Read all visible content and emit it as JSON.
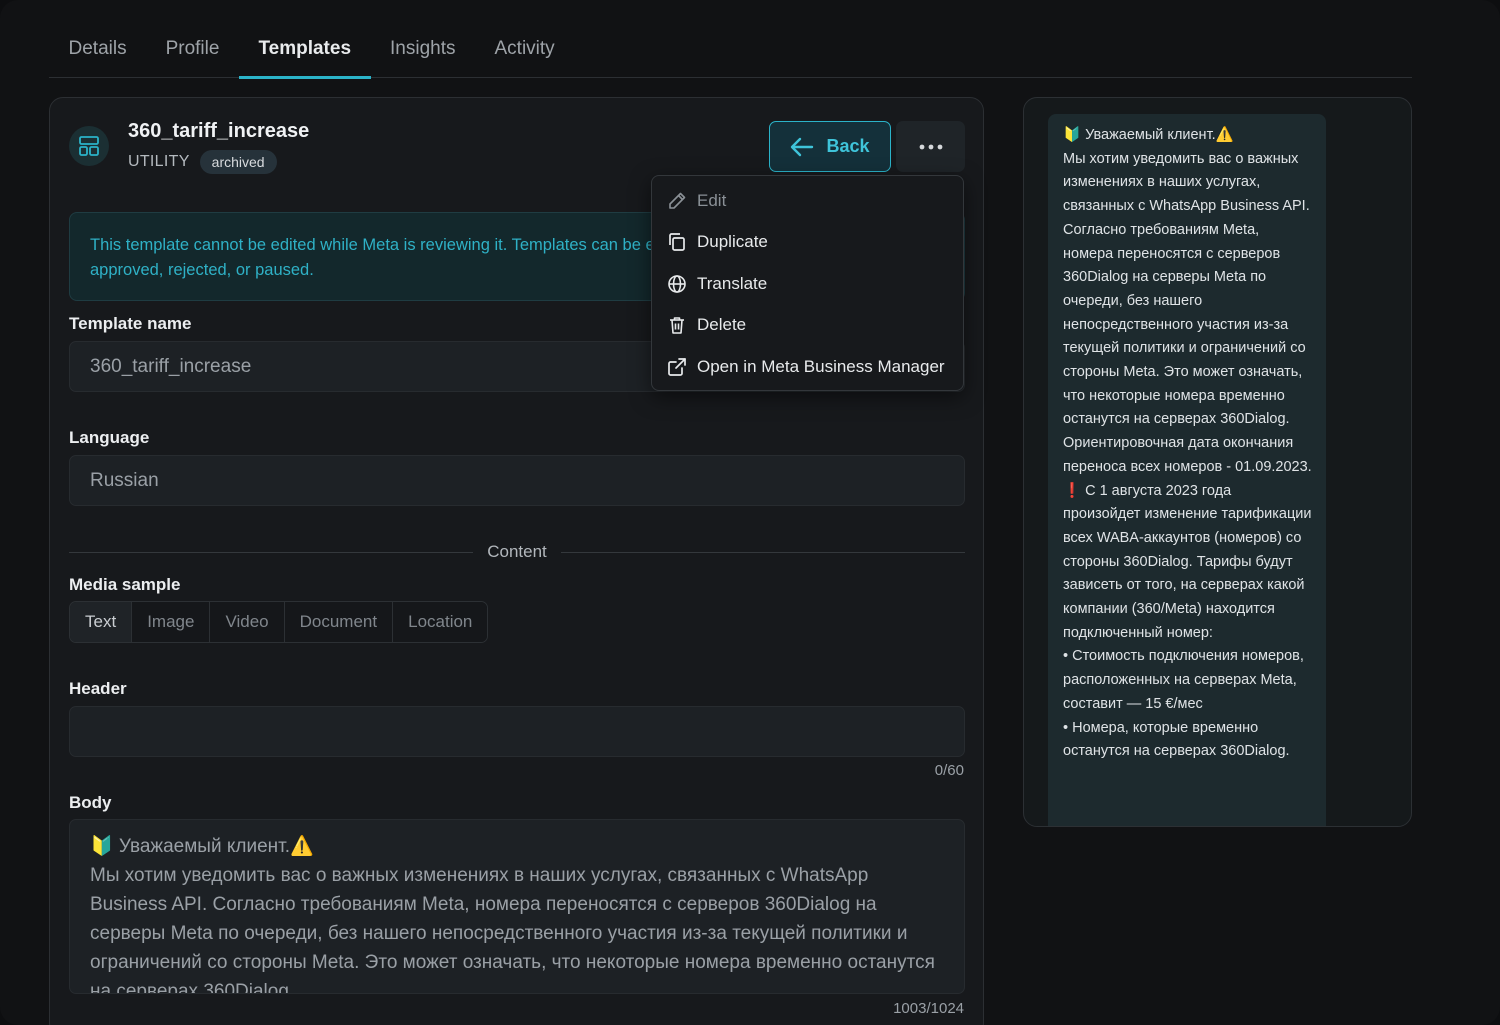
{
  "tabs": [
    {
      "label": "Details",
      "active": false
    },
    {
      "label": "Profile",
      "active": false
    },
    {
      "label": "Templates",
      "active": true
    },
    {
      "label": "Insights",
      "active": false
    },
    {
      "label": "Activity",
      "active": false
    }
  ],
  "template": {
    "icon": "template-layout-icon",
    "name": "360_tariff_increase",
    "category": "UTILITY",
    "status": "archived"
  },
  "actions": {
    "back_label": "Back",
    "back_icon": "arrow-left-icon",
    "more_icon": "more-dots-icon"
  },
  "alert": {
    "text": "This template cannot be edited while Meta is reviewing it. Templates can be edited once Meta has marked them approved, rejected, or paused."
  },
  "form": {
    "template_name_label": "Template name",
    "template_name_value": "360_tariff_increase",
    "language_label": "Language",
    "language_value": "Russian",
    "content_divider": "Content",
    "media_sample_label": "Media sample",
    "media_options": [
      {
        "label": "Text",
        "active": true
      },
      {
        "label": "Image",
        "active": false
      },
      {
        "label": "Video",
        "active": false
      },
      {
        "label": "Document",
        "active": false
      },
      {
        "label": "Location",
        "active": false
      }
    ],
    "header_label": "Header",
    "header_value": "",
    "header_counter": "0/60",
    "body_label": "Body",
    "body_value": "🔰 Уважаемый клиент.⚠️\nМы хотим уведомить вас о важных изменениях в наших услугах, связанных с WhatsApp Business API. Согласно требованиям Meta, номера переносятся с серверов 360Dialog на серверы Meta по очереди, без нашего непосредственного участия из-за текущей политики и ограничений со стороны Meta. Это может означать, что некоторые номера временно останутся на серверах 360Dialog.",
    "body_counter": "1003/1024"
  },
  "menu": {
    "items": [
      {
        "label": "Edit",
        "icon": "pencil-icon",
        "disabled": true
      },
      {
        "label": "Duplicate",
        "icon": "duplicate-icon",
        "disabled": false
      },
      {
        "label": "Translate",
        "icon": "globe-icon",
        "disabled": false
      },
      {
        "label": "Delete",
        "icon": "trash-icon",
        "disabled": false
      },
      {
        "label": "Open in Meta Business Manager",
        "icon": "external-link-icon",
        "disabled": false
      }
    ]
  },
  "preview": {
    "text": "🔰 Уважаемый клиент.⚠️\nМы хотим уведомить вас о важных изменениях в наших услугах, связанных с WhatsApp Business API. Согласно требованиям Meta, номера переносятся с серверов 360Dialog на серверы Meta по очереди, без нашего непосредственного участия из-за текущей политики и ограничений со стороны Meta. Это может означать, что некоторые номера временно останутся на серверах 360Dialog. Ориентировочная дата окончания переноса всех номеров - 01.09.2023.\n❗ С 1 августа 2023 года произойдет изменение тарификации всех WABA-аккаунтов (номеров) со стороны 360Dialog. Тарифы будут зависеть от того, на серверах какой компании (360/Meta) находится подключенный номер:\n• Стоимость подключения номеров, расположенных на серверах Meta, составит — 15 €/мес\n• Номера, которые временно останутся на серверах 360Dialog."
  },
  "colors": {
    "accent": "#2bb3c9",
    "background": "#111214",
    "panel": "#17191c"
  }
}
